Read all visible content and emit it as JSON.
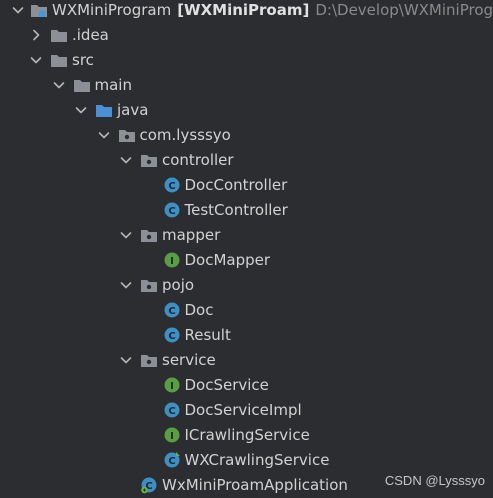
{
  "project": {
    "name": "WXMiniProgram",
    "module": "[WXMiniProam]",
    "path": "D:\\Develop\\WXMiniProg"
  },
  "tree": [
    {
      "label": "WXMiniProgram",
      "level": 0,
      "expanded": true,
      "icon": "project-folder-icon",
      "kind": "project"
    },
    {
      "label": ".idea",
      "level": 1,
      "expanded": false,
      "icon": "folder-icon",
      "kind": "folder"
    },
    {
      "label": "src",
      "level": 1,
      "expanded": true,
      "icon": "folder-icon",
      "kind": "folder"
    },
    {
      "label": "main",
      "level": 2,
      "expanded": true,
      "icon": "folder-icon",
      "kind": "folder"
    },
    {
      "label": "java",
      "level": 3,
      "expanded": true,
      "icon": "source-folder-icon",
      "kind": "source"
    },
    {
      "label": "com.lysssyo",
      "level": 4,
      "expanded": true,
      "icon": "package-icon",
      "kind": "package"
    },
    {
      "label": "controller",
      "level": 5,
      "expanded": true,
      "icon": "package-icon",
      "kind": "package"
    },
    {
      "label": "DocController",
      "level": 6,
      "icon": "class-icon",
      "kind": "class"
    },
    {
      "label": "TestController",
      "level": 6,
      "icon": "class-icon",
      "kind": "class"
    },
    {
      "label": "mapper",
      "level": 5,
      "expanded": true,
      "icon": "package-icon",
      "kind": "package"
    },
    {
      "label": "DocMapper",
      "level": 6,
      "icon": "interface-icon",
      "kind": "interface"
    },
    {
      "label": "pojo",
      "level": 5,
      "expanded": true,
      "icon": "package-icon",
      "kind": "package"
    },
    {
      "label": "Doc",
      "level": 6,
      "icon": "class-icon",
      "kind": "class"
    },
    {
      "label": "Result",
      "level": 6,
      "icon": "class-icon",
      "kind": "class"
    },
    {
      "label": "service",
      "level": 5,
      "expanded": true,
      "icon": "package-icon",
      "kind": "package"
    },
    {
      "label": "DocService",
      "level": 6,
      "icon": "interface-icon",
      "kind": "interface"
    },
    {
      "label": "DocServiceImpl",
      "level": 6,
      "icon": "class-icon",
      "kind": "class"
    },
    {
      "label": "ICrawlingService",
      "level": 6,
      "icon": "interface-icon",
      "kind": "interface"
    },
    {
      "label": "WXCrawlingService",
      "level": 6,
      "icon": "implementing-class-icon",
      "kind": "class-impl"
    },
    {
      "label": "WxMiniProamApplication",
      "level": 5,
      "icon": "spring-app-class-icon",
      "kind": "app"
    }
  ],
  "watermark": "CSDN @Lysssyo",
  "colors": {
    "background": "#2b2d30",
    "folder": "#8c9096",
    "source_folder": "#4a90d9",
    "class": "#3d8fc4",
    "interface": "#5a9e44",
    "text": "#d2d2d2",
    "path": "#8a8a8a"
  }
}
